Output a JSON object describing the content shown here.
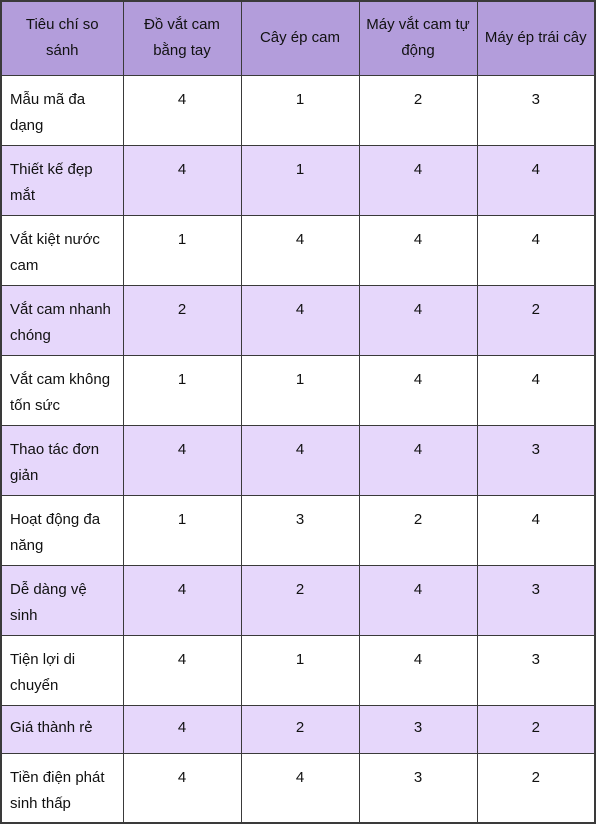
{
  "table": {
    "columns": [
      {
        "key": "criteria",
        "label": "Tiêu chí so sánh",
        "type": "criteria"
      },
      {
        "key": "do_vat_cam_bang_tay",
        "label": "Đồ vắt cam bằng tay",
        "type": "value"
      },
      {
        "key": "cay_ep_cam",
        "label": "Cây ép cam",
        "type": "value"
      },
      {
        "key": "may_vat_cam_tu_dong",
        "label": "Máy vắt cam tự động",
        "type": "value"
      },
      {
        "key": "may_ep_trai_cay",
        "label": "Máy ép trái cây",
        "type": "value"
      }
    ],
    "rows": [
      {
        "criteria": "Mẫu mã đa dạng",
        "values": [
          "4",
          "1",
          "2",
          "3"
        ],
        "striped": false,
        "short": false
      },
      {
        "criteria": "Thiết kế đẹp mắt",
        "values": [
          "4",
          "1",
          "4",
          "4"
        ],
        "striped": true,
        "short": false
      },
      {
        "criteria": "Vắt kiệt nước cam",
        "values": [
          "1",
          "4",
          "4",
          "4"
        ],
        "striped": false,
        "short": false
      },
      {
        "criteria": "Vắt cam nhanh chóng",
        "values": [
          "2",
          "4",
          "4",
          "2"
        ],
        "striped": true,
        "short": false
      },
      {
        "criteria": "Vắt cam không tốn sức",
        "values": [
          "1",
          "1",
          "4",
          "4"
        ],
        "striped": false,
        "short": false
      },
      {
        "criteria": "Thao tác đơn giản",
        "values": [
          "4",
          "4",
          "4",
          "3"
        ],
        "striped": true,
        "short": false
      },
      {
        "criteria": "Hoạt động đa năng",
        "values": [
          "1",
          "3",
          "2",
          "4"
        ],
        "striped": false,
        "short": false
      },
      {
        "criteria": "Dễ dàng vệ sinh",
        "values": [
          "4",
          "2",
          "4",
          "3"
        ],
        "striped": true,
        "short": false
      },
      {
        "criteria": "Tiện lợi di chuyển",
        "values": [
          "4",
          "1",
          "4",
          "3"
        ],
        "striped": false,
        "short": false
      },
      {
        "criteria": "Giá thành rẻ",
        "values": [
          "4",
          "2",
          "3",
          "2"
        ],
        "striped": true,
        "short": true
      },
      {
        "criteria": "Tiền điện phát sinh thấp",
        "values": [
          "4",
          "4",
          "3",
          "2"
        ],
        "striped": false,
        "short": false
      }
    ],
    "colors": {
      "header_background": "#B39DDB",
      "striped_row_background": "#E6D7FB",
      "default_row_background": "#FFFFFF",
      "border": "#3A3A3A",
      "text": "#111111"
    }
  }
}
